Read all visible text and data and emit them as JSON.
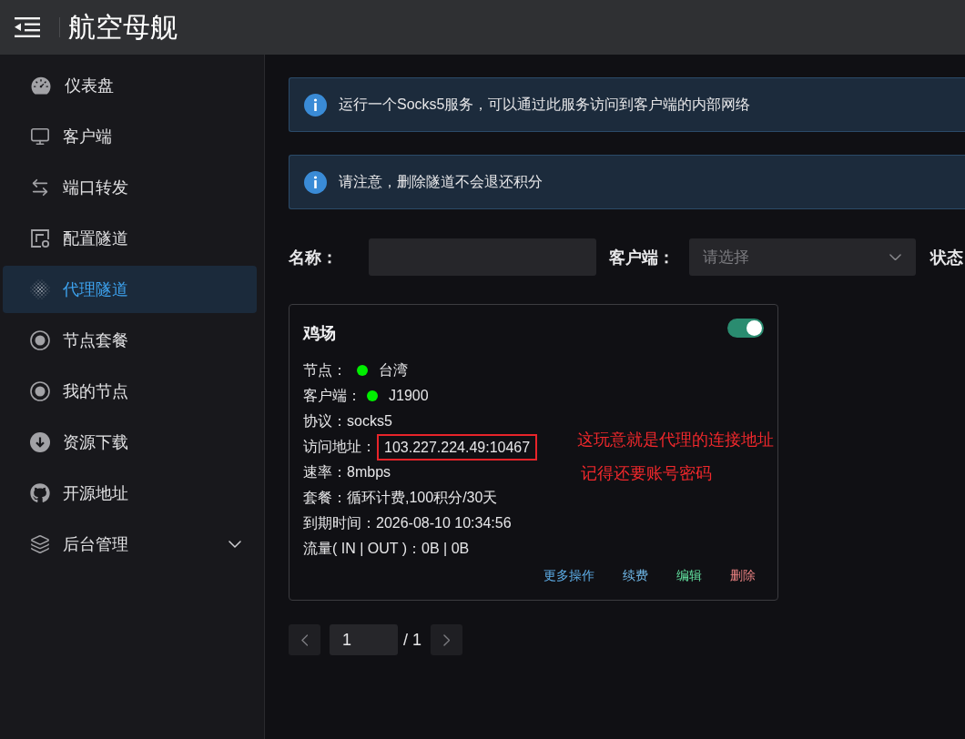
{
  "header": {
    "title": "航空母舰"
  },
  "sidebar": {
    "items": [
      {
        "label": "仪表盘",
        "selected": false
      },
      {
        "label": "客户端",
        "selected": false
      },
      {
        "label": "端口转发",
        "selected": false
      },
      {
        "label": "配置隧道",
        "selected": false
      },
      {
        "label": "代理隧道",
        "selected": true
      },
      {
        "label": "节点套餐",
        "selected": false
      },
      {
        "label": "我的节点",
        "selected": false
      },
      {
        "label": "资源下载",
        "selected": false
      },
      {
        "label": "开源地址",
        "selected": false
      }
    ],
    "group": {
      "label": "后台管理",
      "selected": false,
      "expanded": false
    }
  },
  "alerts": [
    {
      "text": "运行一个Socks5服务，可以通过此服务访问到客户端的内部网络"
    },
    {
      "text": "请注意，删除隧道不会退还积分"
    }
  ],
  "filters": {
    "name_label": "名称：",
    "client_label": "客户端：",
    "client_select": {
      "placeholder": "请选择"
    },
    "status_label": "状态"
  },
  "card": {
    "title": "鸡场",
    "enabled": true,
    "fields": [
      {
        "label": "节点：",
        "value": "台湾",
        "color": "#00ee00",
        "boxed": false
      },
      {
        "label": "客户端：",
        "value": "J1900",
        "color": "#00ee00",
        "boxed": false
      },
      {
        "label": "协议：",
        "value": "socks5",
        "boxed": false
      },
      {
        "label": "访问地址：",
        "value": "103.227.224.49:10467",
        "boxed": true
      },
      {
        "label": "速率：",
        "value": "8mbps",
        "boxed": false
      },
      {
        "label": "套餐：",
        "value": "循环计费,100积分/30天",
        "boxed": false
      },
      {
        "label": "到期时间：",
        "value": "2026-08-10 10:34:56",
        "boxed": false
      },
      {
        "label": "流量( IN | OUT )：",
        "value": "0B | 0B",
        "boxed": false
      }
    ],
    "annotations": [
      {
        "text": "这玩意就是代理的连接地址"
      },
      {
        "text": "记得还要账号密码"
      }
    ],
    "actions": [
      {
        "label": "更多操作",
        "color": "#5eaee8"
      },
      {
        "label": "续费",
        "color": "#70b8e8"
      },
      {
        "label": "编辑",
        "color": "#63e2a0"
      },
      {
        "label": "删除",
        "color": "#e88080"
      }
    ]
  },
  "pagination": {
    "page": "1",
    "total": "/ 1"
  }
}
